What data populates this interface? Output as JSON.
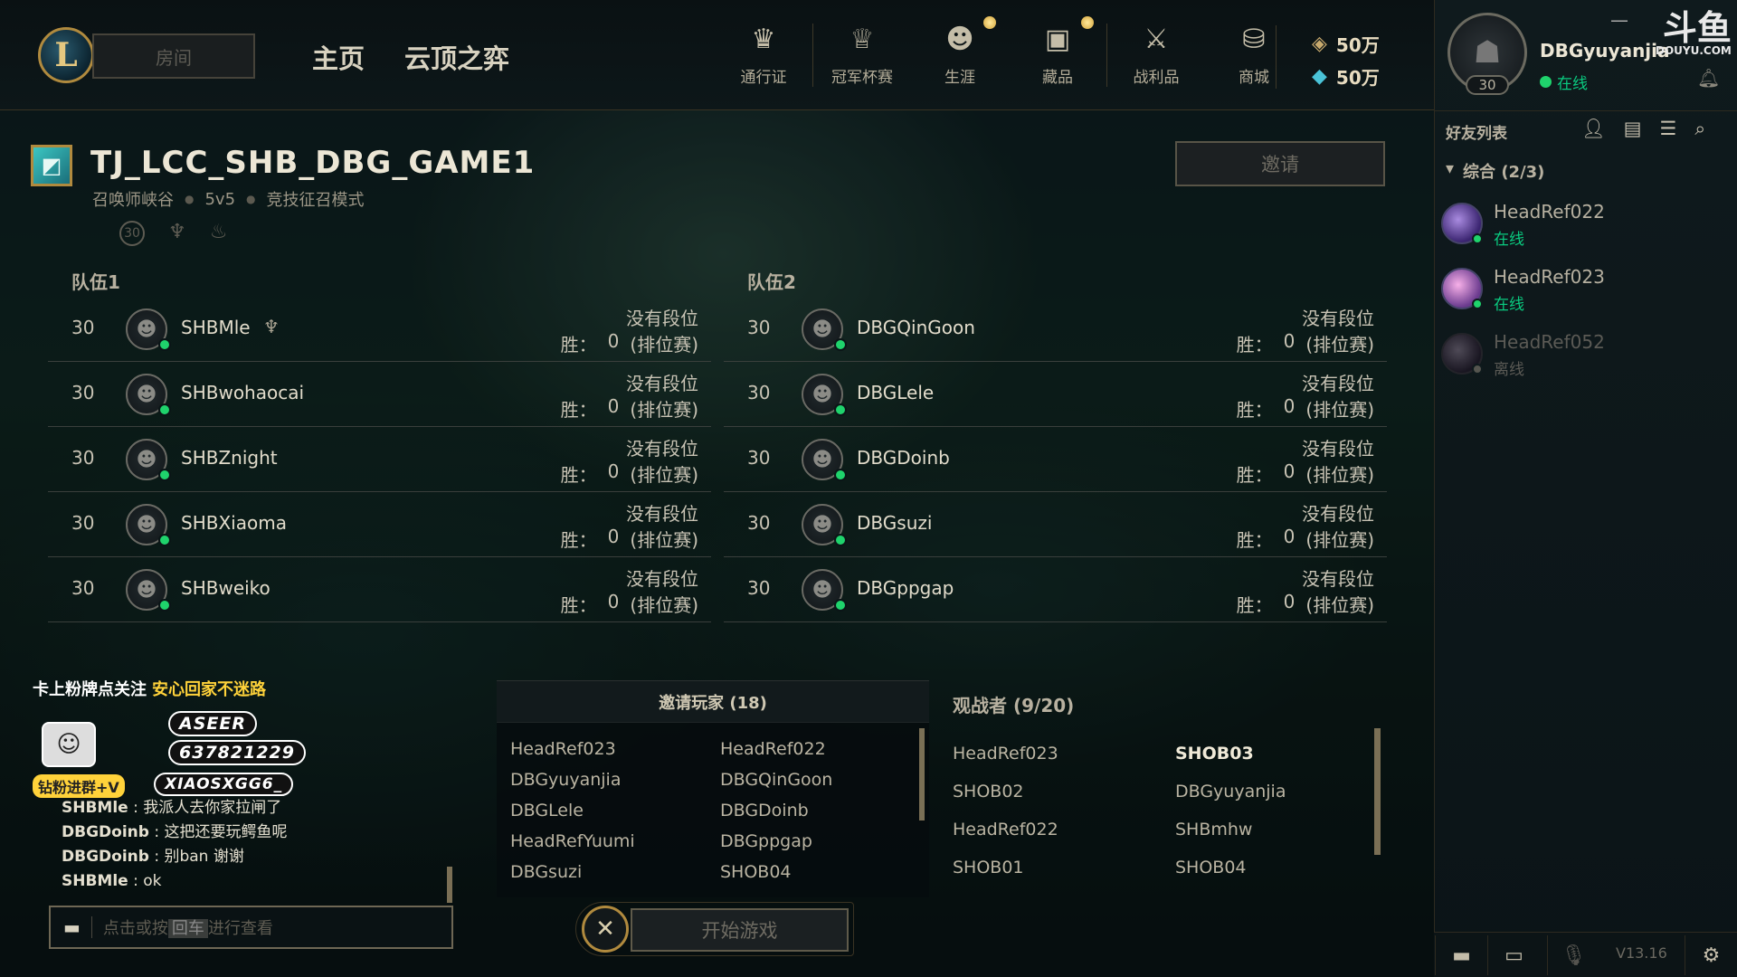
{
  "topbar": {
    "logo_letter": "L",
    "room_button": "房间",
    "main_nav": [
      "主页",
      "云顶之弈"
    ],
    "icon_nav": [
      {
        "icon": "crown-pass-icon",
        "glyph": "♛",
        "label": "通行证",
        "dot": false
      },
      {
        "icon": "trophy-icon",
        "glyph": "♕",
        "label": "冠军杯赛",
        "dot": false
      },
      {
        "icon": "profile-icon",
        "glyph": "☻",
        "label": "生涯",
        "dot": true
      },
      {
        "icon": "collection-icon",
        "glyph": "▣",
        "label": "藏品",
        "dot": true
      },
      {
        "icon": "loot-icon",
        "glyph": "⚔",
        "label": "战利品",
        "dot": false
      },
      {
        "icon": "store-icon",
        "glyph": "⛁",
        "label": "商城",
        "dot": false
      }
    ],
    "currency": {
      "blue_essence": "50万",
      "riot_points": "50万"
    }
  },
  "profile": {
    "name": "DBGyuyanjia",
    "level": "30",
    "status": "在线",
    "watermark_main": "斗鱼",
    "watermark_sub": "DOUYU.COM"
  },
  "lobby": {
    "title": "TJ_LCC_SHB_DBG_GAME1",
    "map": "召唤师峡谷",
    "size": "5v5",
    "mode": "竞技征召模式",
    "icon_level": "30",
    "invite_button": "邀请"
  },
  "team1": {
    "label": "队伍1",
    "players": [
      {
        "level": "30",
        "name": "SHBMle",
        "badge": "♆",
        "rank": "没有段位",
        "wins_label": "胜：",
        "wins": "0",
        "queue": "(排位赛)"
      },
      {
        "level": "30",
        "name": "SHBwohaocai",
        "badge": "",
        "rank": "没有段位",
        "wins_label": "胜：",
        "wins": "0",
        "queue": "(排位赛)"
      },
      {
        "level": "30",
        "name": "SHBZnight",
        "badge": "",
        "rank": "没有段位",
        "wins_label": "胜：",
        "wins": "0",
        "queue": "(排位赛)"
      },
      {
        "level": "30",
        "name": "SHBXiaoma",
        "badge": "",
        "rank": "没有段位",
        "wins_label": "胜：",
        "wins": "0",
        "queue": "(排位赛)"
      },
      {
        "level": "30",
        "name": "SHBweiko",
        "badge": "",
        "rank": "没有段位",
        "wins_label": "胜：",
        "wins": "0",
        "queue": "(排位赛)"
      }
    ]
  },
  "team2": {
    "label": "队伍2",
    "players": [
      {
        "level": "30",
        "name": "DBGQinGoon",
        "badge": "",
        "rank": "没有段位",
        "wins_label": "胜：",
        "wins": "0",
        "queue": "(排位赛)"
      },
      {
        "level": "30",
        "name": "DBGLele",
        "badge": "",
        "rank": "没有段位",
        "wins_label": "胜：",
        "wins": "0",
        "queue": "(排位赛)"
      },
      {
        "level": "30",
        "name": "DBGDoinb",
        "badge": "",
        "rank": "没有段位",
        "wins_label": "胜：",
        "wins": "0",
        "queue": "(排位赛)"
      },
      {
        "level": "30",
        "name": "DBGsuzi",
        "badge": "",
        "rank": "没有段位",
        "wins_label": "胜：",
        "wins": "0",
        "queue": "(排位赛)"
      },
      {
        "level": "30",
        "name": "DBGppgap",
        "badge": "",
        "rank": "没有段位",
        "wins_label": "胜：",
        "wins": "0",
        "queue": "(排位赛)"
      }
    ]
  },
  "overlay": {
    "line1_white": "卡上粉牌点关注",
    "line1_yellow": "安心回家不迷路",
    "weibo": "ASEER",
    "qq": "637821229",
    "fan_group": "钻粉进群+V",
    "wechat": "XIAOSXGG6_"
  },
  "chat": {
    "messages": [
      {
        "who": "SHBMle",
        "text": "我派人去你家拉闸了"
      },
      {
        "who": "DBGDoinb",
        "text": "这把还要玩鳄鱼呢"
      },
      {
        "who": "DBGDoinb",
        "text": "别ban 谢谢"
      },
      {
        "who": "SHBMle",
        "text": "ok"
      }
    ],
    "input_hint_a": "点击或按",
    "input_hint_key": "回车",
    "input_hint_b": "进行查看"
  },
  "invited": {
    "title": "邀请玩家 (18)",
    "players": [
      "HeadRef023",
      "HeadRef022",
      "DBGyuyanjia",
      "DBGQinGoon",
      "DBGLele",
      "DBGDoinb",
      "HeadRefYuumi",
      "DBGppgap",
      "DBGsuzi",
      "SHOB04"
    ]
  },
  "spectators": {
    "title": "观战者 (9/20)",
    "players": [
      "HeadRef023",
      "SHOB03",
      "SHOB02",
      "DBGyuyanjia",
      "HeadRef022",
      "SHBmhw",
      "SHOB01",
      "SHOB04"
    ],
    "highlighted": [
      "SHOB03"
    ]
  },
  "start": {
    "label": "开始游戏",
    "cancel_glyph": "✕"
  },
  "friends": {
    "title": "好友列表",
    "group": "综合 (2/3)",
    "list": [
      {
        "name": "HeadRef022",
        "status": "在线",
        "online": true
      },
      {
        "name": "HeadRef023",
        "status": "在线",
        "online": true
      },
      {
        "name": "HeadRef052",
        "status": "离线",
        "online": false
      }
    ],
    "version": "V13.16"
  }
}
